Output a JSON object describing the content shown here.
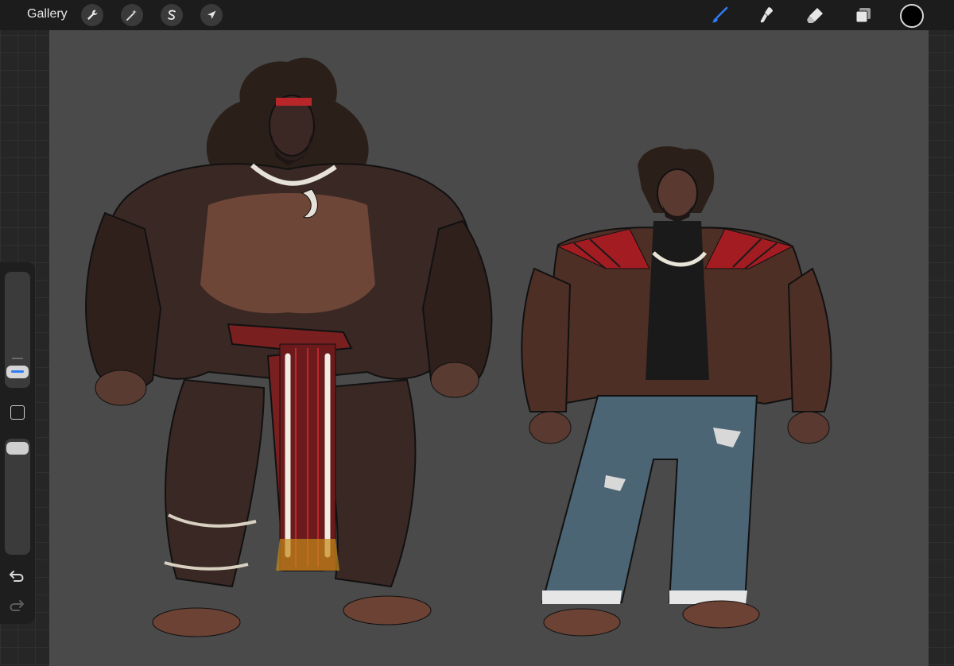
{
  "topbar": {
    "gallery_label": "Gallery",
    "left_tools": [
      {
        "name": "actions",
        "icon": "wrench-icon"
      },
      {
        "name": "adjustments",
        "icon": "magic-wand-icon"
      },
      {
        "name": "selection",
        "icon": "selection-s-icon"
      },
      {
        "name": "transform",
        "icon": "arrow-cursor-icon"
      }
    ],
    "right_tools": [
      {
        "name": "brush",
        "icon": "brush-icon",
        "active": true
      },
      {
        "name": "smudge",
        "icon": "smudge-icon",
        "active": false
      },
      {
        "name": "eraser",
        "icon": "eraser-icon",
        "active": false
      },
      {
        "name": "layers",
        "icon": "layers-icon",
        "active": false
      }
    ],
    "current_color": "#000000",
    "active_color": "#2f7cf6"
  },
  "sidebar": {
    "brush_size_level": 0.82,
    "opacity_level": 0.97,
    "controls": [
      "brush-size-slider",
      "modify-button",
      "opacity-slider",
      "undo-button",
      "redo-button"
    ]
  },
  "canvas": {
    "background": "#4a4a4a",
    "content": "character-sketches"
  }
}
